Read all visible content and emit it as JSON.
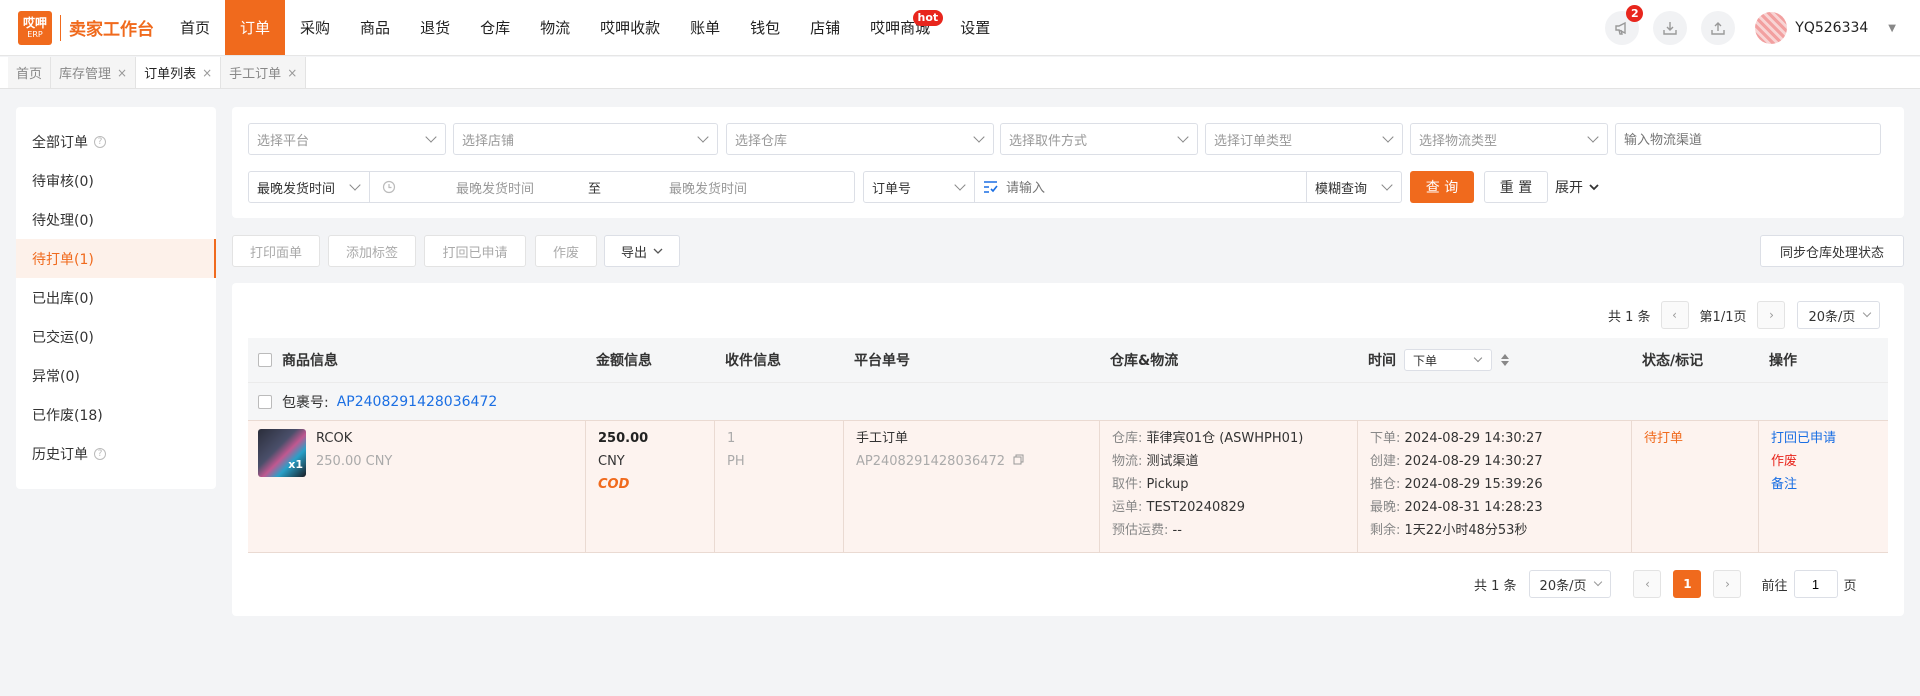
{
  "brand": {
    "logo_top": "哎呷",
    "logo_bottom": "ERP",
    "title": "卖家工作台"
  },
  "nav": {
    "items": [
      "首页",
      "订单",
      "采购",
      "商品",
      "退货",
      "仓库",
      "物流",
      "哎呷收款",
      "账单",
      "钱包",
      "店铺",
      "哎呷商城",
      "设置"
    ],
    "hot_label": "hot",
    "notif_count": "2",
    "username": "YQ526334"
  },
  "tabs": [
    {
      "label": "首页",
      "close": ""
    },
    {
      "label": "库存管理",
      "close": "×"
    },
    {
      "label": "订单列表",
      "close": "×"
    },
    {
      "label": "手工订单",
      "close": "×"
    }
  ],
  "sidebar": {
    "items": [
      "全部订单",
      "待审核(0)",
      "待处理(0)",
      "待打单(1)",
      "已出库(0)",
      "已交运(0)",
      "异常(0)",
      "已作废(18)",
      "历史订单"
    ]
  },
  "filters": {
    "platform": "选择平台",
    "shop": "选择店铺",
    "warehouse": "选择仓库",
    "pickup": "选择取件方式",
    "order_type": "选择订单类型",
    "logistics_type": "选择物流类型",
    "channel_placeholder": "输入物流渠道",
    "time_type": "最晚发货时间",
    "time_start": "最晚发货时间",
    "time_sep": "至",
    "time_end": "最晚发货时间",
    "field": "订单号",
    "search_placeholder": "请输入",
    "match": "模糊查询",
    "query": "查 询",
    "reset": "重 置",
    "expand": "展开"
  },
  "actions": {
    "print_label": "打印面单",
    "add_tag": "添加标签",
    "recall": "打回已申请",
    "void": "作废",
    "export": "导出",
    "sync": "同步仓库处理状态"
  },
  "pager_top": {
    "total": "共 1 条",
    "page": "第1/1页",
    "size": "20条/页"
  },
  "table": {
    "headers": {
      "product": "商品信息",
      "amount": "金额信息",
      "receiver": "收件信息",
      "platform_no": "平台单号",
      "warehouse": "仓库&物流",
      "time": "时间",
      "time_sort": "下单",
      "status": "状态/标记",
      "ops": "操作"
    },
    "package_label": "包裹号:",
    "package_no": "AP2408291428036472",
    "row": {
      "qty": "x1",
      "product_name": "RCOK",
      "product_price": "250.00 CNY",
      "amount": "250.00",
      "currency": "CNY",
      "payment": "COD",
      "receiver_qty": "1",
      "receiver_country": "PH",
      "order_type": "手工订单",
      "platform_no": "AP2408291428036472",
      "wh_labels": [
        "仓库:",
        "物流:",
        "取件:",
        "运单:",
        "预估运费:"
      ],
      "wh_values": [
        "菲律宾01仓 (ASWHPH01)",
        "测试渠道",
        "Pickup",
        "TEST20240829",
        "--"
      ],
      "time_labels": [
        "下单:",
        "创建:",
        "推仓:",
        "最晚:",
        "剩余:"
      ],
      "time_values": [
        "2024-08-29 14:30:27",
        "2024-08-29 14:30:27",
        "2024-08-29 15:39:26",
        "2024-08-31 14:28:23",
        "1天22小时48分53秒"
      ],
      "status": "待打单",
      "ops": [
        "打回已申请",
        "作废",
        "备注"
      ]
    }
  },
  "pager_bottom": {
    "total": "共 1 条",
    "size": "20条/页",
    "current": "1",
    "goto_label": "前往",
    "goto_value": "1",
    "page_unit": "页"
  },
  "colors": {
    "accent": "#f06a1d",
    "link": "#1b6fe3",
    "danger": "#e8261d"
  }
}
